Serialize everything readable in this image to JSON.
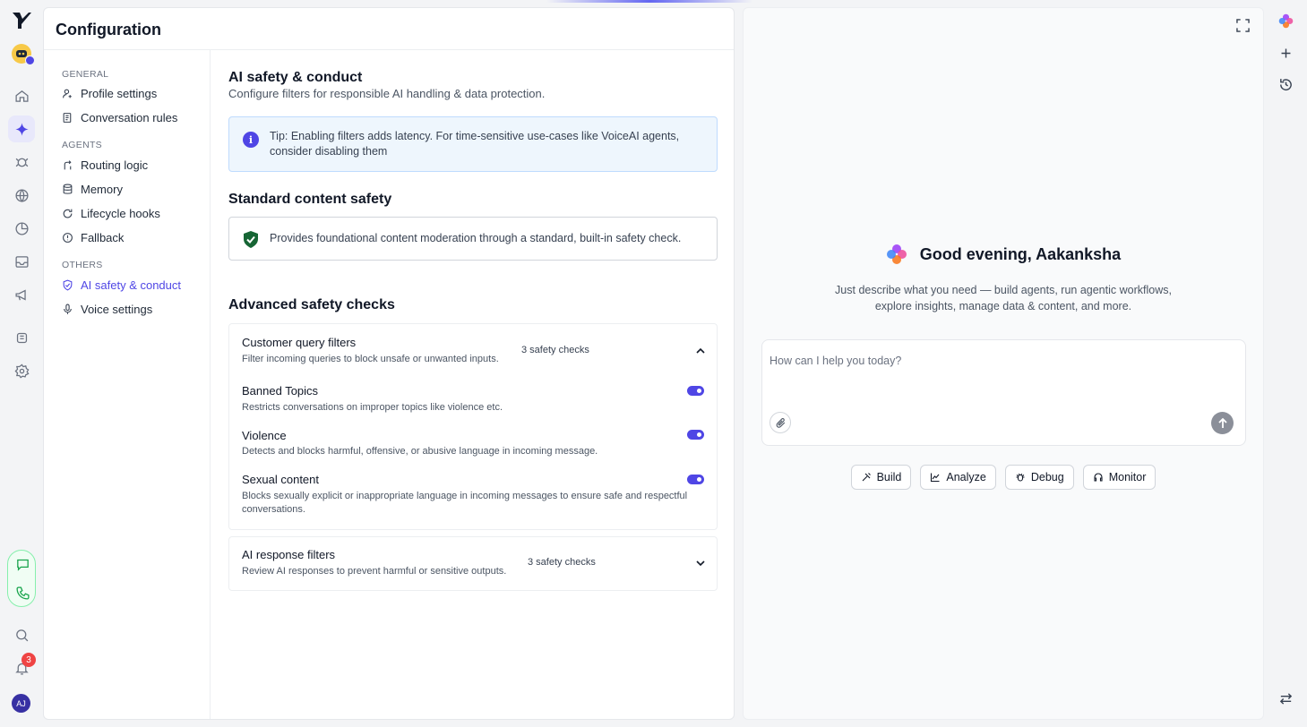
{
  "config": {
    "title": "Configuration",
    "nav": {
      "general_label": "GENERAL",
      "agents_label": "AGENTS",
      "others_label": "OTHERS",
      "items": [
        {
          "label": "Profile settings",
          "icon": "user-gear-icon"
        },
        {
          "label": "Conversation rules",
          "icon": "rules-icon"
        },
        {
          "label": "Routing logic",
          "icon": "routing-icon"
        },
        {
          "label": "Memory",
          "icon": "database-icon"
        },
        {
          "label": "Lifecycle hooks",
          "icon": "refresh-icon"
        },
        {
          "label": "Fallback",
          "icon": "alert-circle-icon"
        },
        {
          "label": "AI safety & conduct",
          "icon": "shield-check-icon",
          "active": true
        },
        {
          "label": "Voice settings",
          "icon": "microphone-icon"
        }
      ]
    },
    "main": {
      "title": "AI safety & conduct",
      "subtitle": "Configure filters for responsible AI handling & data protection.",
      "tip": "Tip: Enabling filters adds latency. For time-sensitive use-cases like VoiceAI agents, consider disabling them",
      "standard_title": "Standard content safety",
      "standard_text": "Provides foundational content moderation through a standard, built-in safety check.",
      "advanced_title": "Advanced safety checks",
      "customer": {
        "title": "Customer query filters",
        "desc": "Filter incoming queries to block unsafe or unwanted inputs.",
        "count": "3 safety checks",
        "expanded": true,
        "filters": [
          {
            "title": "Banned Topics",
            "desc": "Restricts conversations on improper topics like violence etc.",
            "enabled": true
          },
          {
            "title": "Violence",
            "desc": "Detects and blocks harmful, offensive, or abusive language in incoming message.",
            "enabled": true
          },
          {
            "title": "Sexual content",
            "desc": "Blocks sexually explicit or inappropriate language in incoming messages to ensure safe and respectful conversations.",
            "enabled": true
          }
        ]
      },
      "response": {
        "title": "AI response filters",
        "desc": "Review AI responses to prevent harmful or sensitive outputs.",
        "count": "3 safety checks",
        "expanded": false
      }
    }
  },
  "assistant": {
    "greeting": "Good evening, Aakanksha",
    "subtext": "Just describe what you need — build agents, run agentic workflows, explore insights, manage data & content, and more.",
    "placeholder": "How can I help you today?",
    "chips": [
      {
        "label": "Build",
        "icon": "tools-icon"
      },
      {
        "label": "Analyze",
        "icon": "chart-icon"
      },
      {
        "label": "Debug",
        "icon": "bug-icon"
      },
      {
        "label": "Monitor",
        "icon": "headphones-icon"
      }
    ]
  },
  "rail": {
    "notification_count": "3",
    "user_initials": "AJ"
  },
  "colors": {
    "accent": "#4f46e5",
    "call_green": "#16a34a",
    "badge_red": "#ef4444"
  }
}
